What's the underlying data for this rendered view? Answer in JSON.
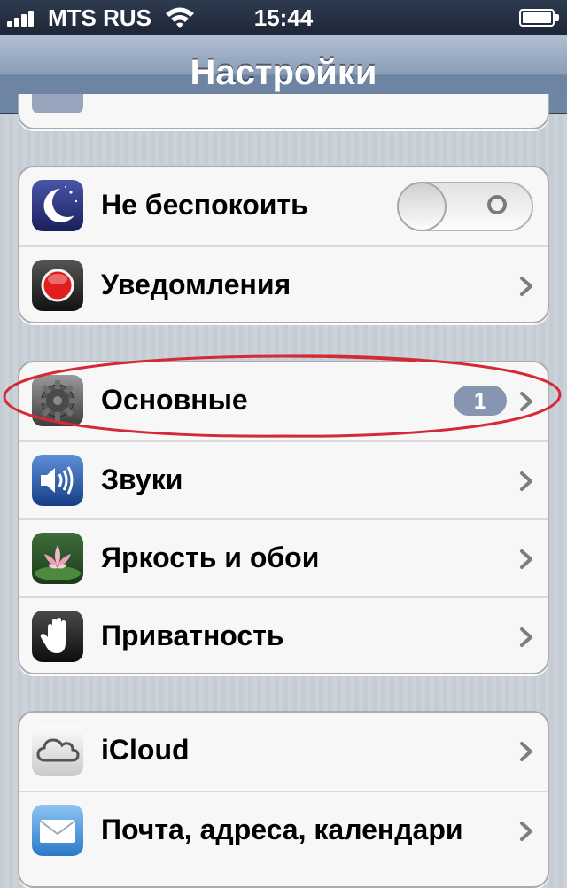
{
  "status_bar": {
    "carrier": "MTS RUS",
    "time": "15:44",
    "battery_level": 1.0,
    "icons": [
      "signal-icon",
      "wifi-icon",
      "battery-icon"
    ]
  },
  "nav": {
    "title": "Настройки"
  },
  "groups": [
    {
      "items": [
        {
          "label": "Не беспокоить",
          "icon": "moon-icon",
          "control": "toggle",
          "toggle_on": false
        },
        {
          "label": "Уведомления",
          "icon": "notifications-icon",
          "control": "chevron"
        }
      ]
    },
    {
      "items": [
        {
          "label": "Основные",
          "icon": "gear-icon",
          "control": "chevron",
          "badge": "1"
        },
        {
          "label": "Звуки",
          "icon": "speaker-icon",
          "control": "chevron"
        },
        {
          "label": "Яркость и обои",
          "icon": "flower-icon",
          "control": "chevron"
        },
        {
          "label": "Приватность",
          "icon": "hand-icon",
          "control": "chevron"
        }
      ]
    },
    {
      "items": [
        {
          "label": "iCloud",
          "icon": "cloud-icon",
          "control": "chevron"
        },
        {
          "label": "Почта, адреса, календари",
          "icon": "mail-icon",
          "control": "chevron"
        }
      ]
    }
  ],
  "colors": {
    "nav_bar": "#6d84a2",
    "badge": "#8696b0",
    "annotation_circle": "#d42a35",
    "background": "#c5ccd4"
  }
}
